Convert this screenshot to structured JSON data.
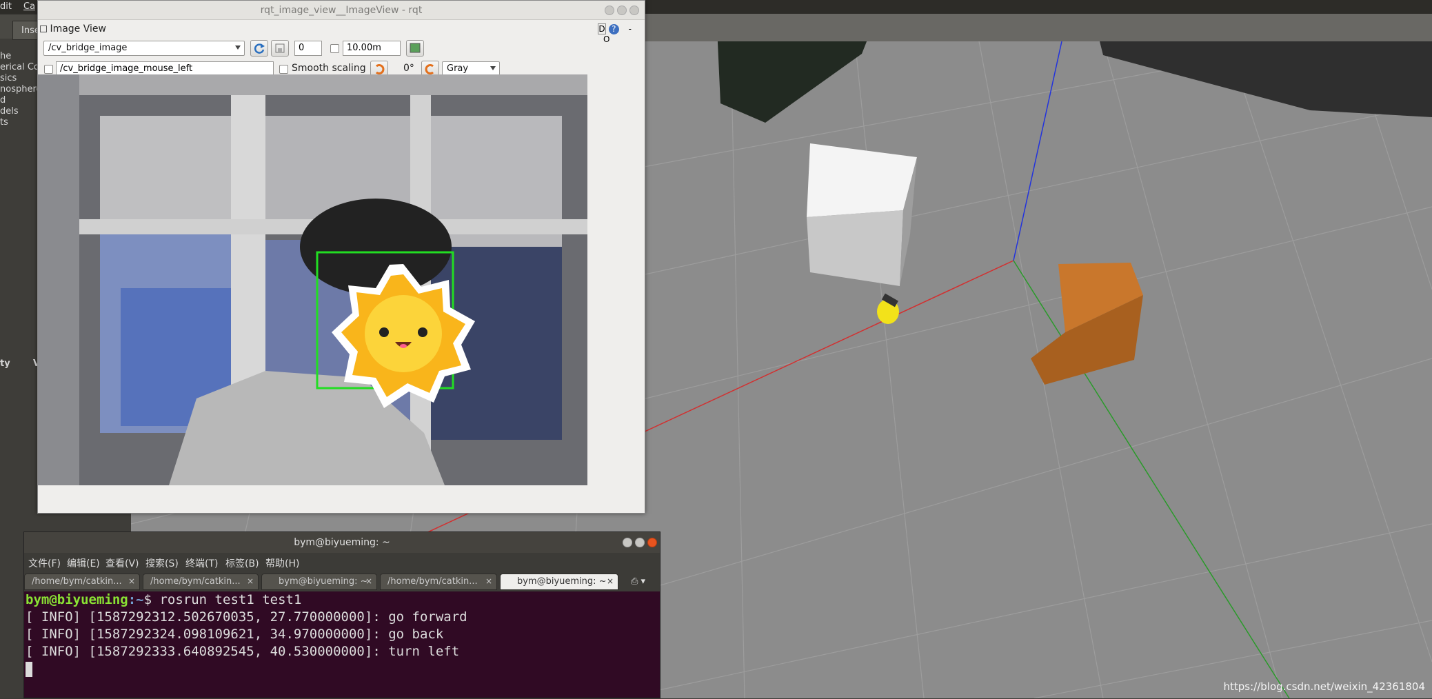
{
  "topbar": {
    "items": [
      "dit",
      "Ca"
    ]
  },
  "gazebo": {
    "tab_label": "Inse",
    "tree_items": [
      "he",
      "erical Co",
      "sics",
      "nosphere",
      "d",
      "dels",
      "ts"
    ],
    "property_header": "ty",
    "value_header": "V"
  },
  "rqt": {
    "window_title": "rqt_image_view__ImageView - rqt",
    "plugin_title": "Image View",
    "plugin_controls": [
      "D",
      "?",
      "-",
      "O"
    ],
    "topic": "/cv_bridge_image",
    "spin_value": "0",
    "max_range": "10.00m",
    "mouse_topic": "/cv_bridge_image_mouse_left",
    "smooth_scaling_label": "Smooth scaling",
    "rotation": "0°",
    "color_scheme": "Gray"
  },
  "terminal": {
    "title": "bym@biyueming: ~",
    "menu": [
      "文件(F)",
      "编辑(E)",
      "查看(V)",
      "搜索(S)",
      "终端(T)",
      "标签(B)",
      "帮助(H)"
    ],
    "tabs": [
      {
        "label": "/home/bym/catkin...",
        "active": false
      },
      {
        "label": "/home/bym/catkin...",
        "active": false
      },
      {
        "label": "bym@biyueming: ~",
        "active": false
      },
      {
        "label": "/home/bym/catkin...",
        "active": false
      },
      {
        "label": "bym@biyueming: ~",
        "active": true
      }
    ],
    "prompt_user": "bym@biyueming",
    "prompt_path": ":~",
    "command": "$ rosrun test1 test1",
    "lines": [
      "[ INFO] [1587292312.502670035, 27.770000000]: go forward",
      "[ INFO] [1587292324.098109621, 34.970000000]: go back",
      "[ INFO] [1587292333.640892545, 40.530000000]: turn left"
    ]
  },
  "watermark": "https://blog.csdn.net/weixin_42361804",
  "colors": {
    "terminal_bg": "#300a24",
    "prompt_green": "#8ae234",
    "detection_box": "#22dd22",
    "sun_body": "#f9b51b"
  }
}
